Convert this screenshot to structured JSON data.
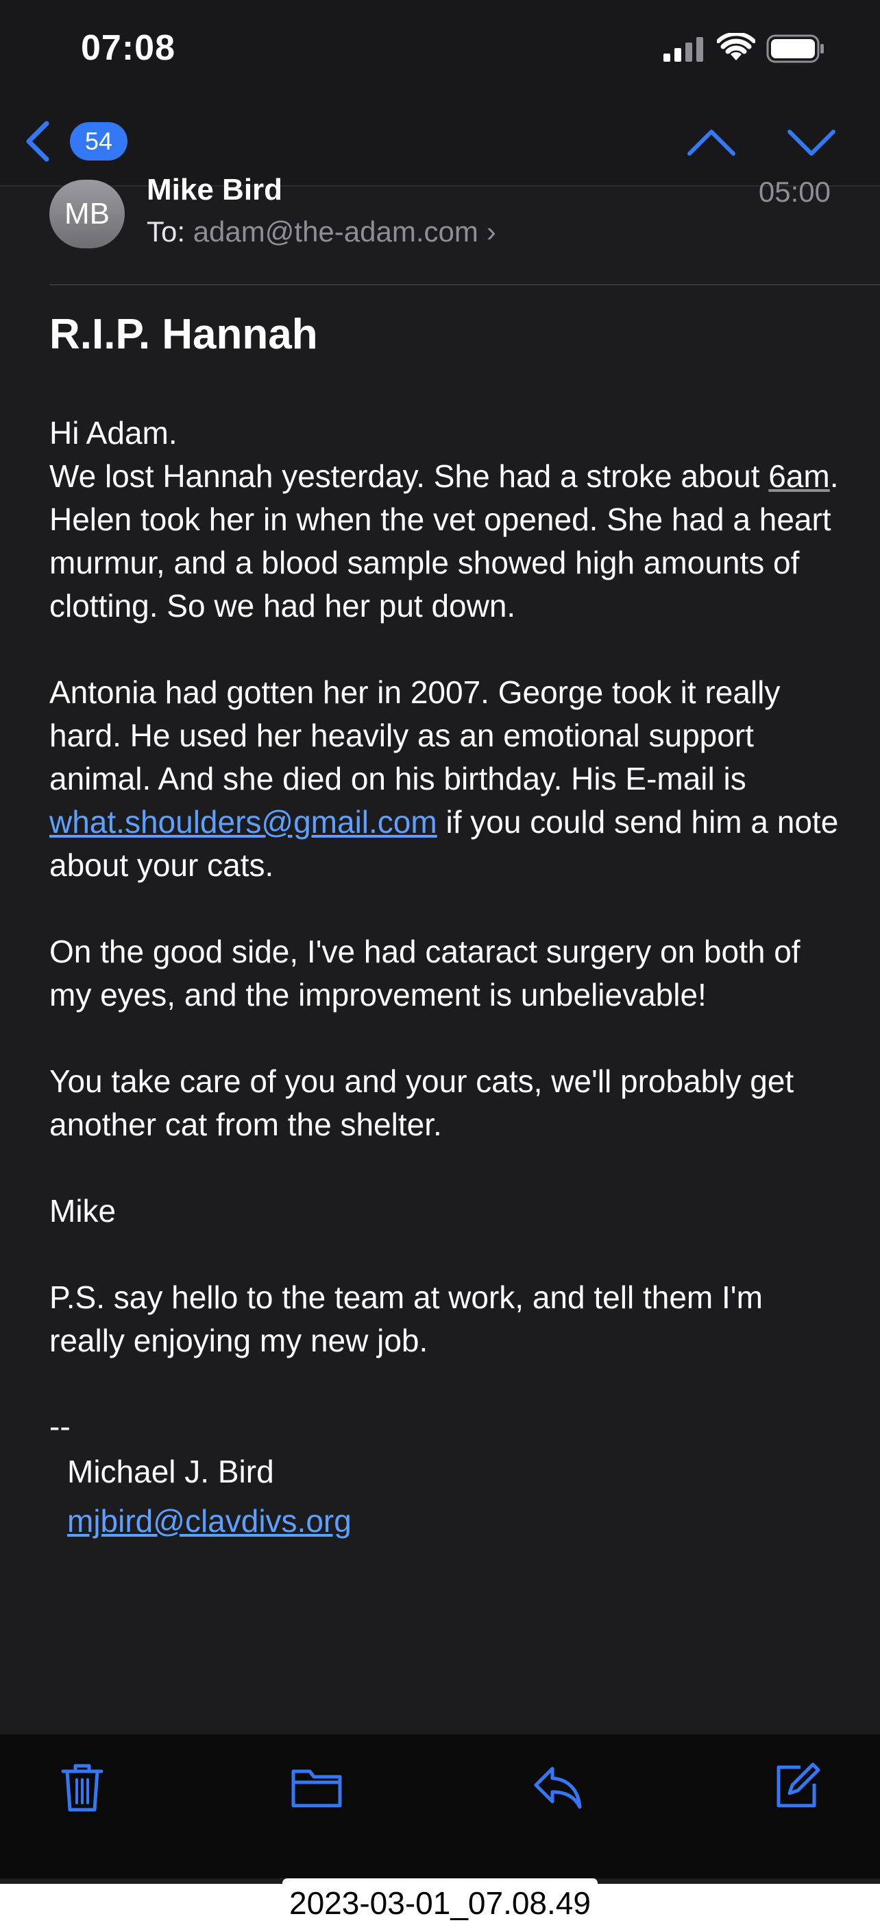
{
  "status": {
    "time": "07:08",
    "icons": [
      "cellular-signal-icon",
      "wifi-icon",
      "battery-icon"
    ]
  },
  "nav": {
    "back_count": "54",
    "icons": [
      "back-chevron-icon",
      "previous-message-icon",
      "next-message-icon"
    ]
  },
  "message": {
    "avatar_initials": "MB",
    "sender": "Mike Bird",
    "date": "05:00",
    "to_label": "To:",
    "to_address": "adam@the-adam.com",
    "to_chevron": "›",
    "subject": "R.I.P. Hannah",
    "p1_line1": "Hi Adam.",
    "p1_a": "We lost Hannah yesterday. She had a stroke about ",
    "p1_time": "6am",
    "p1_b": ". Helen took her in when the vet opened. She had a heart murmur, and a blood sample showed high amounts of clotting. So we had her put down.",
    "p2_a": "Antonia had gotten her in 2007. George took it really hard. He used her heavily as an emotional support animal. And she died on his birthday. His E-mail is ",
    "p2_link": "what.shoulders@gmail.com",
    "p2_b": " if you could send him a note about your cats.",
    "p3": "On the good side, I've had cataract surgery on both of my eyes, and the improvement is unbelievable!",
    "p4": "You take care of you and your cats, we'll probably get another cat from the shelter.",
    "p5": "Mike",
    "p6": "P.S. say hello to the team at work, and tell them I'm really enjoying my new job.",
    "sig_dash": "--",
    "sig_name": "Michael J. Bird",
    "sig_email": "mjbird@clavdivs.org"
  },
  "toolbar": {
    "icons": [
      "trash-icon",
      "folder-icon",
      "reply-icon",
      "compose-icon"
    ]
  },
  "accent_color": "#3478f6",
  "link_color": "#5ea0ff",
  "footer_stamp": "2023-03-01_07.08.49"
}
